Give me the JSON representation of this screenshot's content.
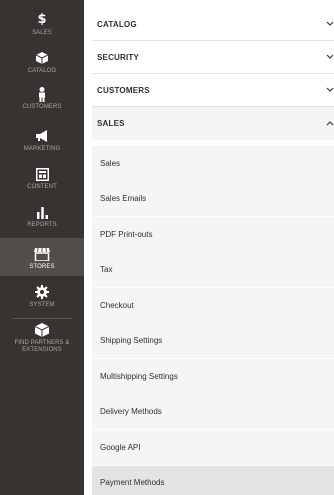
{
  "admin_menu": {
    "items": [
      {
        "label": "SALES",
        "icon": "dollar-icon"
      },
      {
        "label": "CATALOG",
        "icon": "box-icon"
      },
      {
        "label": "CUSTOMERS",
        "icon": "person-icon"
      },
      {
        "label": "MARKETING",
        "icon": "megaphone-icon"
      },
      {
        "label": "CONTENT",
        "icon": "layout-icon"
      },
      {
        "label": "REPORTS",
        "icon": "bar-chart-icon"
      },
      {
        "label": "STORES",
        "icon": "storefront-icon"
      },
      {
        "label": "SYSTEM",
        "icon": "gear-icon"
      },
      {
        "label": "FIND PARTNERS & EXTENSIONS",
        "icon": "cube-icon"
      }
    ],
    "active": "STORES"
  },
  "config_sections": [
    {
      "label": "CATALOG",
      "expanded": false
    },
    {
      "label": "SECURITY",
      "expanded": false
    },
    {
      "label": "CUSTOMERS",
      "expanded": false
    },
    {
      "label": "SALES",
      "expanded": true
    }
  ],
  "sales_items": [
    "Sales",
    "Sales Emails",
    "PDF Print-outs",
    "Tax",
    "Checkout",
    "Shipping Settings",
    "Multishipping Settings",
    "Delivery Methods",
    "Google API",
    "Payment Methods"
  ],
  "selected_item": "Payment Methods"
}
